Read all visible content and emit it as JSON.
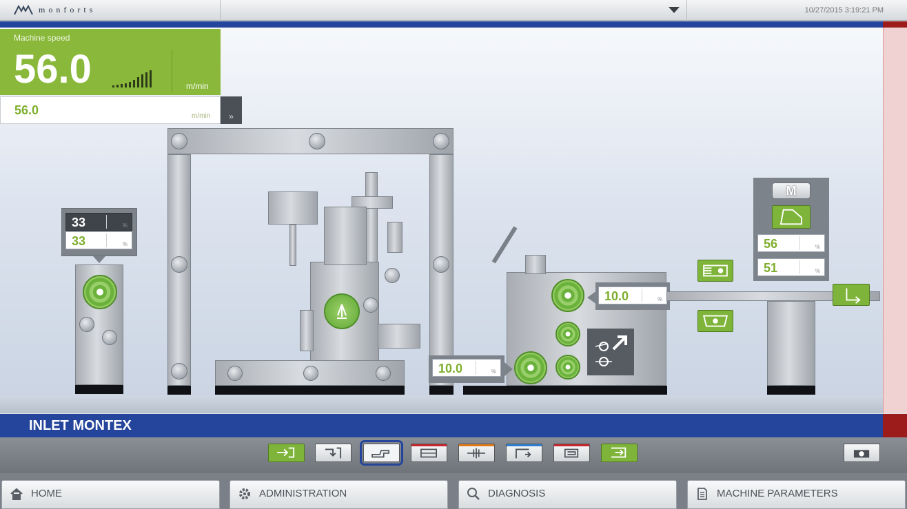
{
  "header": {
    "brand": "monforts",
    "datetime": "10/27/2015 3:19:21 PM"
  },
  "speed_panel": {
    "label": "Machine speed",
    "actual_value": "56.0",
    "actual_unit": "m/min",
    "setpoint_value": "56.0",
    "setpoint_unit": "m/min",
    "expand_label": "»"
  },
  "unwinder": {
    "actual": "33",
    "setpoint": "33",
    "unit": "%"
  },
  "padder": {
    "top_value": "10.0",
    "bottom_value": "10.0",
    "unit": "%"
  },
  "inlet_control": {
    "mode_label": "M",
    "value1": "56",
    "value2": "51",
    "unit": "%"
  },
  "section_title": "INLET MONTEX",
  "toolbar": {
    "accent_colors": [
      "#7fb43a",
      "#c7262e",
      "#e07a1a",
      "#2f7fd0"
    ]
  },
  "nav": {
    "home": "HOME",
    "administration": "ADMINISTRATION",
    "diagnosis": "DIAGNOSIS",
    "machine_parameters": "MACHINE PARAMETERS"
  }
}
